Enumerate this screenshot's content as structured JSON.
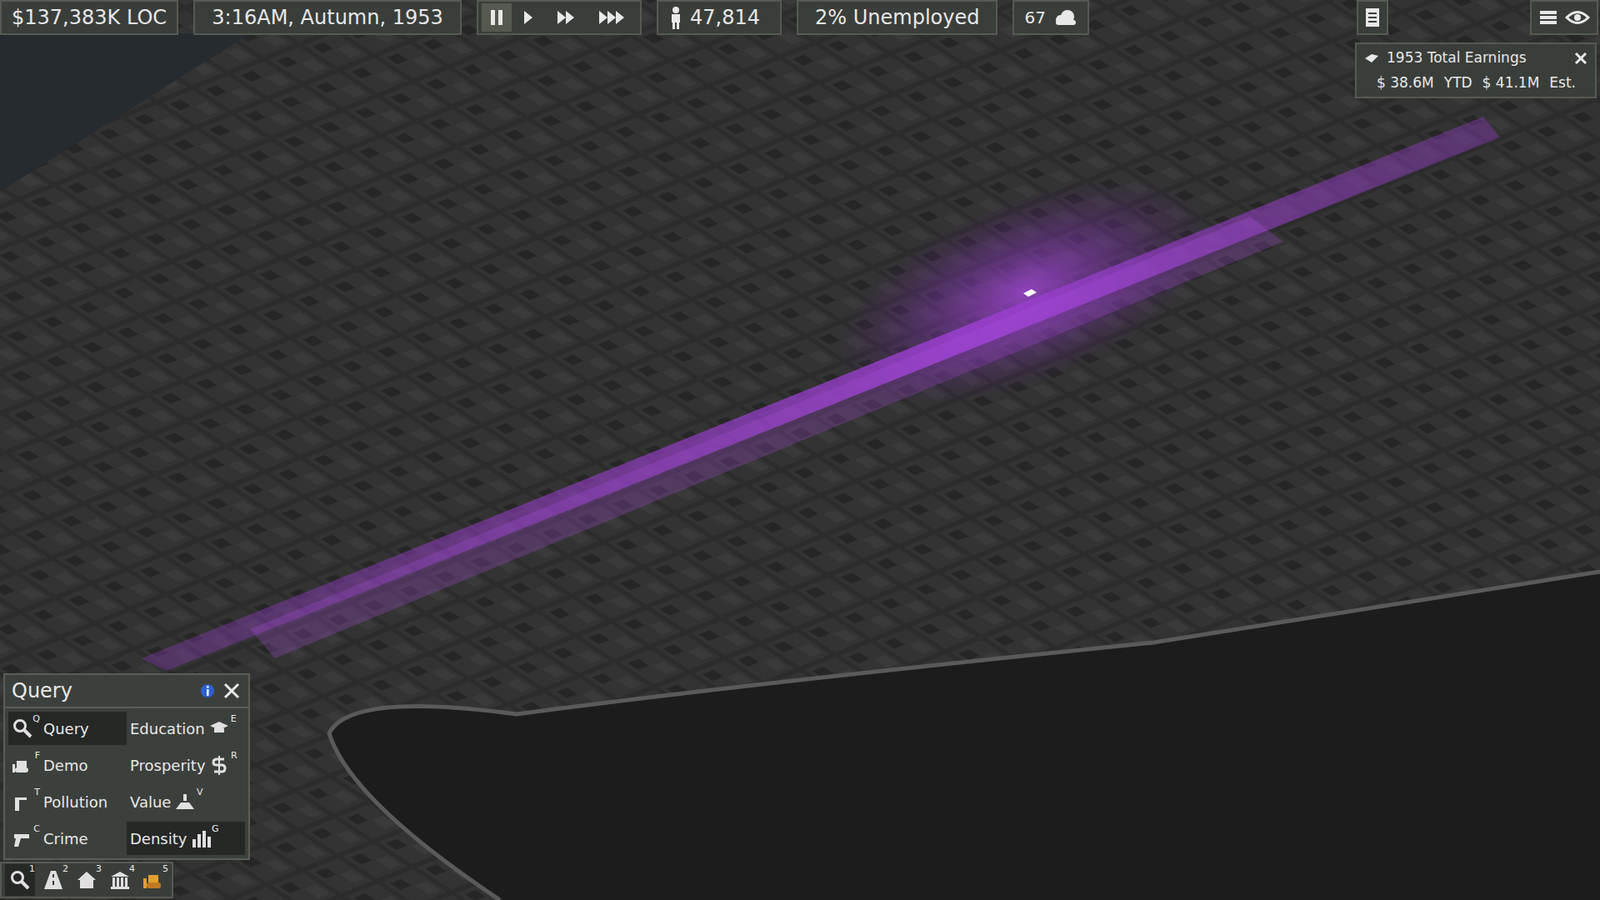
{
  "top_bar": {
    "money": "$137,383K LOC",
    "datetime": "3:16AM, Autumn, 1953",
    "speed_controls": [
      {
        "kind": "pause",
        "selected": true
      },
      {
        "kind": "play",
        "selected": false
      },
      {
        "kind": "fast",
        "selected": false
      },
      {
        "kind": "fastest",
        "selected": false
      }
    ],
    "population": "47,814",
    "unemployment": "2% Unemployed",
    "temperature": "67"
  },
  "earnings_panel": {
    "title": "1953 Total Earnings",
    "ytd_value": "$ 38.6M",
    "ytd_label": "YTD",
    "est_value": "$ 41.1M",
    "est_label": "Est."
  },
  "query_panel": {
    "title": "Query",
    "modes": [
      {
        "label": "Query",
        "hotkey": "Q",
        "kind": "query",
        "selected": true
      },
      {
        "label": "Education",
        "hotkey": "E",
        "kind": "education",
        "selected": false
      },
      {
        "label": "Demo",
        "hotkey": "F",
        "kind": "demo",
        "selected": false
      },
      {
        "label": "Prosperity",
        "hotkey": "R",
        "kind": "prosperity",
        "selected": false
      },
      {
        "label": "Pollution",
        "hotkey": "T",
        "kind": "pollution",
        "selected": false
      },
      {
        "label": "Value",
        "hotkey": "V",
        "kind": "value",
        "selected": false
      },
      {
        "label": "Crime",
        "hotkey": "C",
        "kind": "crime",
        "selected": false
      },
      {
        "label": "Density",
        "hotkey": "G",
        "kind": "density",
        "selected": true
      }
    ]
  },
  "toolbar": [
    {
      "hotkey": "1",
      "kind": "query",
      "selected": true
    },
    {
      "hotkey": "2",
      "kind": "roads",
      "selected": false
    },
    {
      "hotkey": "3",
      "kind": "zones",
      "selected": false
    },
    {
      "hotkey": "4",
      "kind": "buildings",
      "selected": false
    },
    {
      "hotkey": "5",
      "kind": "bulldozer",
      "selected": false
    }
  ]
}
